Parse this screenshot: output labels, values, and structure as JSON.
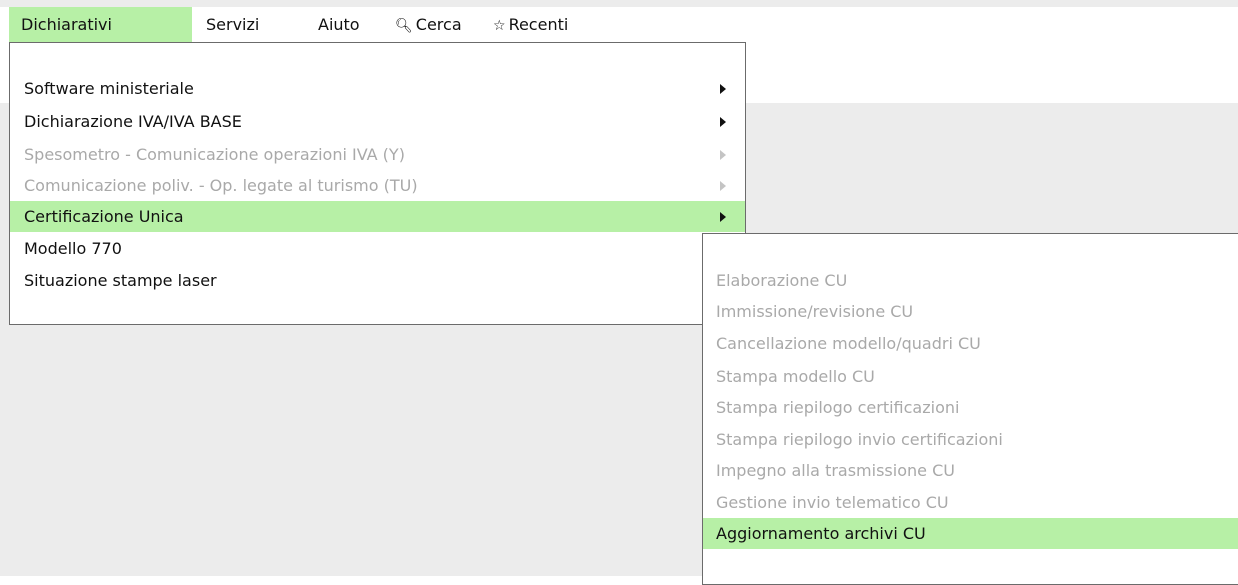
{
  "menubar": {
    "dichiarativi": "Dichiarativi",
    "servizi": "Servizi",
    "aiuto": "Aiuto",
    "cerca": "Cerca",
    "recenti": "Recenti",
    "cerca_icon": "magnifier-icon",
    "recenti_icon": "star-icon"
  },
  "main_menu": {
    "items": [
      {
        "label": "Software ministeriale",
        "enabled": true,
        "submenu": true
      },
      {
        "label": "Dichiarazione IVA/IVA BASE",
        "enabled": true,
        "submenu": true
      },
      {
        "label": "Spesometro - Comunicazione operazioni IVA (Y)",
        "enabled": false,
        "submenu": true
      },
      {
        "label": "Comunicazione poliv. - Op. legate al turismo (TU)",
        "enabled": false,
        "submenu": true
      },
      {
        "label": "Certificazione Unica",
        "enabled": true,
        "submenu": true,
        "highlighted": true
      },
      {
        "label": "Modello 770",
        "enabled": true
      },
      {
        "label": "Situazione stampe laser",
        "enabled": true
      }
    ]
  },
  "sub_menu": {
    "items": [
      {
        "label": "Elaborazione CU",
        "enabled": false
      },
      {
        "label": "Immissione/revisione CU",
        "enabled": false
      },
      {
        "label": "Cancellazione modello/quadri CU",
        "enabled": false
      },
      {
        "label": "Stampa modello CU",
        "enabled": false
      },
      {
        "label": "Stampa riepilogo certificazioni",
        "enabled": false
      },
      {
        "label": "Stampa riepilogo invio certificazioni",
        "enabled": false
      },
      {
        "label": "Impegno alla trasmissione CU",
        "enabled": false
      },
      {
        "label": "Gestione invio telematico CU",
        "enabled": false
      },
      {
        "label": "Aggiornamento archivi CU",
        "enabled": true,
        "highlighted": true
      }
    ]
  },
  "colors": {
    "highlight": "#b7f0a6",
    "workarea": "#ececec",
    "disabled_text": "#a9a9a9"
  }
}
